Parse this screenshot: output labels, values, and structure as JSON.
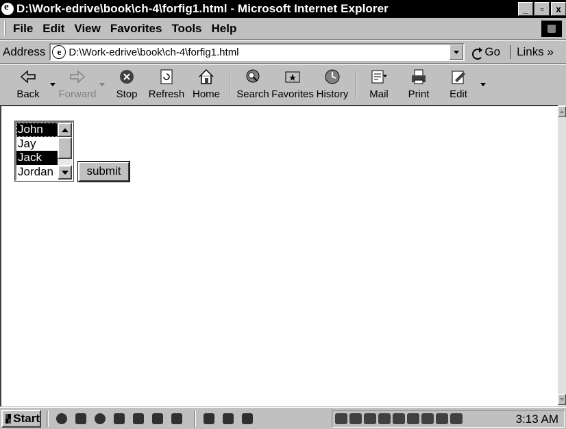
{
  "window": {
    "title": "D:\\Work-edrive\\book\\ch-4\\forfig1.html - Microsoft Internet Explorer",
    "controls": [
      "_",
      "▫",
      "x"
    ]
  },
  "menu": {
    "file": "File",
    "edit": "Edit",
    "view": "View",
    "favorites": "Favorites",
    "tools": "Tools",
    "help": "Help"
  },
  "address": {
    "label": "Address",
    "value": "D:\\Work-edrive\\book\\ch-4\\forfig1.html",
    "go": "Go",
    "links": "Links »"
  },
  "toolbar": {
    "back": "Back",
    "forward": "Forward",
    "stop": "Stop",
    "refresh": "Refresh",
    "home": "Home",
    "search": "Search",
    "favorites": "Favorites",
    "history": "History",
    "mail": "Mail",
    "print": "Print",
    "edit": "Edit"
  },
  "form": {
    "listbox": {
      "options": [
        "John",
        "Jay",
        "Jack",
        "Jordan"
      ],
      "selected": [
        "John",
        "Jack"
      ]
    },
    "submit": "submit"
  },
  "taskbar": {
    "start": "Start",
    "clock": "3:13 AM"
  }
}
